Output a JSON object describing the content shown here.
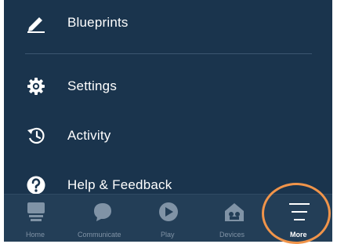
{
  "menu": {
    "items": [
      {
        "label": "Blueprints",
        "icon": "pencil-icon"
      },
      {
        "label": "Settings",
        "icon": "gear-icon"
      },
      {
        "label": "Activity",
        "icon": "history-icon"
      },
      {
        "label": "Help & Feedback",
        "icon": "help-icon"
      }
    ]
  },
  "tabbar": {
    "tabs": [
      {
        "label": "Home",
        "icon": "home-icon"
      },
      {
        "label": "Communicate",
        "icon": "chat-bubble-icon"
      },
      {
        "label": "Play",
        "icon": "play-icon"
      },
      {
        "label": "Devices",
        "icon": "devices-icon"
      },
      {
        "label": "More",
        "icon": "menu-lines-icon",
        "active": true
      }
    ]
  },
  "colors": {
    "background": "#1a344d",
    "tabbar": "#233e57",
    "active": "#ffffff",
    "inactive": "#8093a6",
    "highlight": "#f0944a"
  }
}
